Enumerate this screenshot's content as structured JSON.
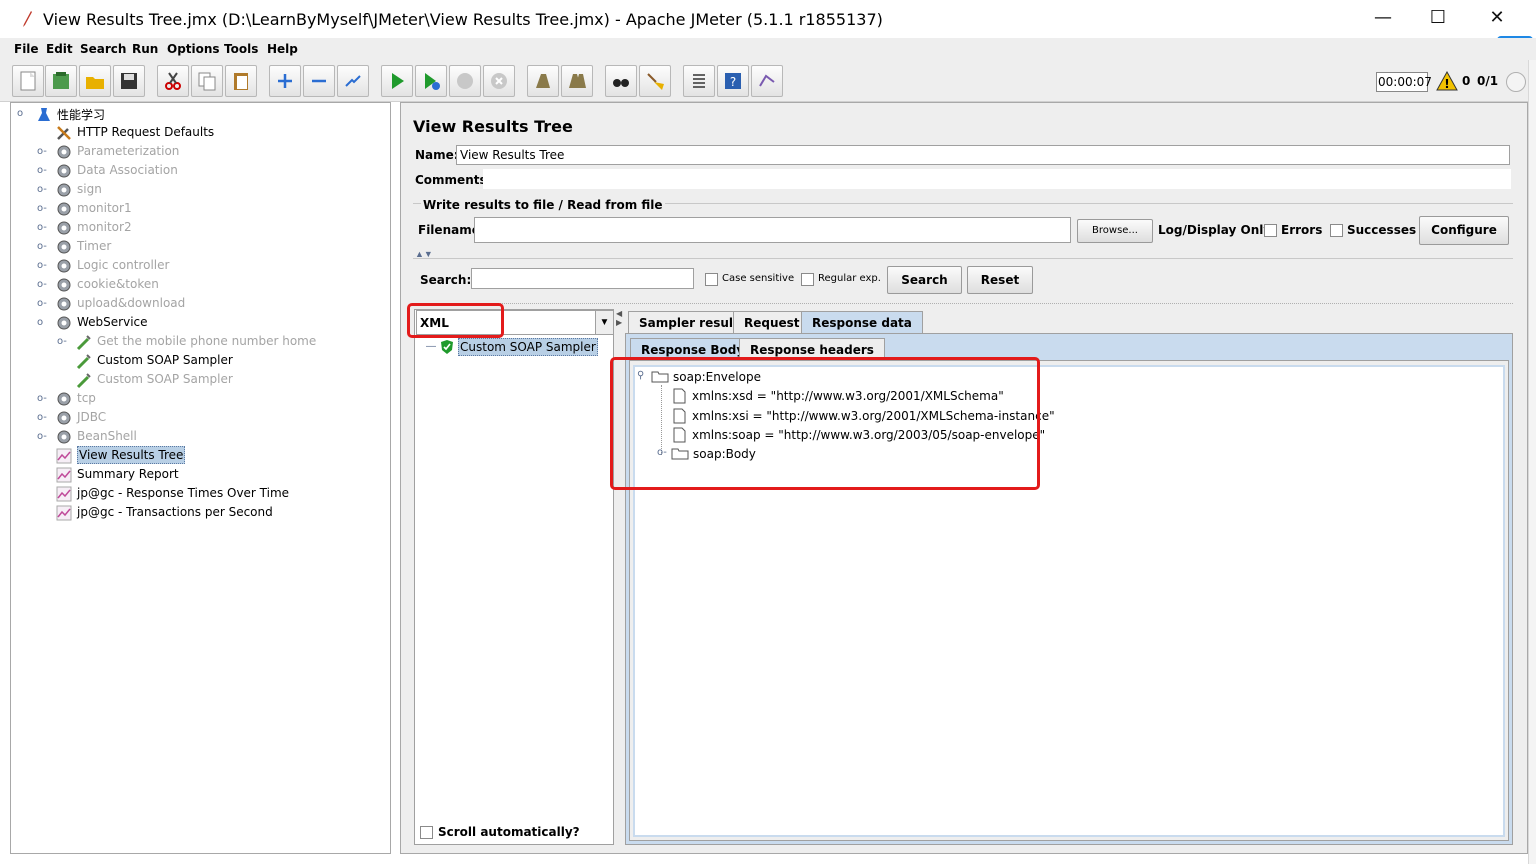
{
  "window": {
    "title": "View Results Tree.jmx (D:\\LearnByMyself\\JMeter\\View Results Tree.jmx) - Apache JMeter (5.1.1 r1855137)",
    "minimize": "—",
    "maximize": "☐",
    "close": "✕"
  },
  "menu": [
    "File",
    "Edit",
    "Search",
    "Run",
    "Options",
    "Tools",
    "Help"
  ],
  "status": {
    "timer": "00:00:07",
    "warnings": "0",
    "threads": "0/1"
  },
  "tree": [
    {
      "label": "性能学习",
      "icon": "test-plan-icon",
      "disabled": false
    },
    {
      "label": "HTTP Request Defaults",
      "icon": "wrench-icon",
      "disabled": false
    },
    {
      "label": "Parameterization",
      "icon": "gear-icon",
      "disabled": true
    },
    {
      "label": "Data Association",
      "icon": "gear-icon",
      "disabled": true
    },
    {
      "label": "sign",
      "icon": "gear-icon",
      "disabled": true
    },
    {
      "label": "monitor1",
      "icon": "gear-icon",
      "disabled": true
    },
    {
      "label": "monitor2",
      "icon": "gear-icon",
      "disabled": true
    },
    {
      "label": "Timer",
      "icon": "gear-icon",
      "disabled": true
    },
    {
      "label": "Logic controller",
      "icon": "gear-icon",
      "disabled": true
    },
    {
      "label": "cookie&token",
      "icon": "gear-icon",
      "disabled": true
    },
    {
      "label": "upload&download",
      "icon": "gear-icon",
      "disabled": true
    },
    {
      "label": "WebService",
      "icon": "gear-icon",
      "disabled": false
    },
    {
      "label": "Get the mobile phone number home",
      "icon": "pipette-icon",
      "disabled": true
    },
    {
      "label": "Custom SOAP Sampler",
      "icon": "pipette-icon",
      "disabled": false
    },
    {
      "label": "Custom SOAP Sampler",
      "icon": "pipette-icon",
      "disabled": true
    },
    {
      "label": "tcp",
      "icon": "gear-icon",
      "disabled": true
    },
    {
      "label": "JDBC",
      "icon": "gear-icon",
      "disabled": true
    },
    {
      "label": "BeanShell",
      "icon": "gear-icon",
      "disabled": true
    },
    {
      "label": "View Results Tree",
      "icon": "graph-icon",
      "disabled": false
    },
    {
      "label": "Summary Report",
      "icon": "graph-icon",
      "disabled": false
    },
    {
      "label": "jp@gc - Response Times Over Time",
      "icon": "graph-icon",
      "disabled": false
    },
    {
      "label": "jp@gc - Transactions per Second",
      "icon": "graph-icon",
      "disabled": false
    }
  ],
  "panel": {
    "title": "View Results Tree",
    "name_label": "Name:",
    "name_value": "View Results Tree",
    "comments_label": "Comments:",
    "write_results_legend": "Write results to file / Read from file",
    "filename_label": "Filename",
    "browse": "Browse...",
    "log_display_only": "Log/Display Only:",
    "errors": "Errors",
    "successes": "Successes",
    "configure": "Configure",
    "search_label": "Search:",
    "case_sensitive": "Case sensitive",
    "regular_exp": "Regular exp.",
    "search_button": "Search",
    "reset_button": "Reset",
    "renderer_selected": "XML",
    "result_item": "Custom SOAP Sampler",
    "scroll_auto": "Scroll automatically?",
    "tabs": [
      "Sampler result",
      "Request",
      "Response data"
    ],
    "subtabs": [
      "Response Body",
      "Response headers"
    ]
  },
  "xml_tree": {
    "root": "soap:Envelope",
    "attrs": [
      "xmlns:xsd = \"http://www.w3.org/2001/XMLSchema\"",
      "xmlns:xsi = \"http://www.w3.org/2001/XMLSchema-instance\"",
      "xmlns:soap = \"http://www.w3.org/2003/05/soap-envelope\""
    ],
    "child": "soap:Body"
  },
  "colors": {
    "highlight_red": "#e31b1b",
    "selection_blue": "#b8cfe5",
    "active_tab": "#c9dbee"
  }
}
